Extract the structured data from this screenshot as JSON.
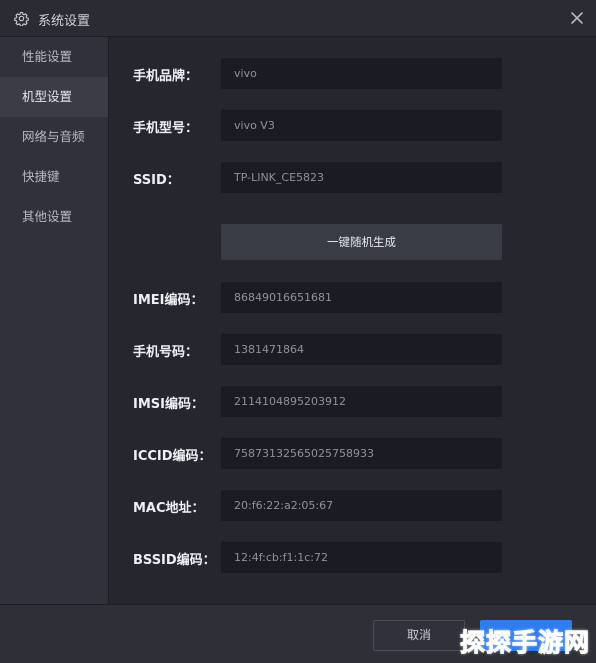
{
  "window": {
    "title": "系统设置"
  },
  "sidebar": {
    "items": [
      {
        "label": "性能设置",
        "active": false
      },
      {
        "label": "机型设置",
        "active": true
      },
      {
        "label": "网络与音频",
        "active": false
      },
      {
        "label": "快捷键",
        "active": false
      },
      {
        "label": "其他设置",
        "active": false
      }
    ]
  },
  "form": {
    "phone_brand": {
      "label": "手机品牌：",
      "value": "vivo"
    },
    "phone_model": {
      "label": "手机型号：",
      "value": "vivo V3"
    },
    "ssid": {
      "label": "SSID：",
      "value": "TP-LINK_CE5823"
    },
    "generate_button": "一键随机生成",
    "imei": {
      "label": "IMEI编码：",
      "value": "86849016651681"
    },
    "phone_number": {
      "label": "手机号码：",
      "value": "1381471864"
    },
    "imsi": {
      "label": "IMSI编码：",
      "value": "2114104895203912"
    },
    "iccid": {
      "label": "ICCID编码：",
      "value": "75873132565025758933"
    },
    "mac": {
      "label": "MAC地址：",
      "value": "20:f6:22:a2:05:67"
    },
    "bssid": {
      "label": "BSSID编码：",
      "value": "12:4f:cb:f1:1c:72"
    }
  },
  "footer": {
    "cancel_label": "取消",
    "confirm_label": ""
  },
  "watermark": "探探手游网",
  "colors": {
    "accent": "#2f7bf0",
    "background": "#26272e",
    "sidebar": "#30313a",
    "field": "#1b1c23"
  },
  "icons": {
    "title": "gear-icon",
    "close": "close-icon"
  }
}
